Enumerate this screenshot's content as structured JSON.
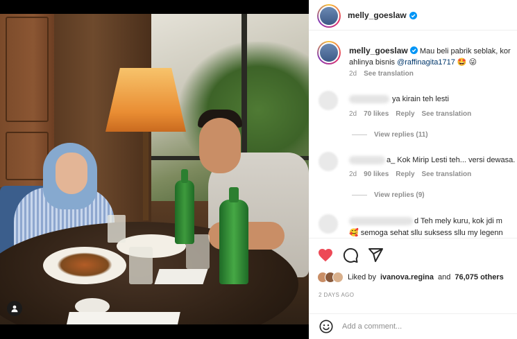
{
  "post": {
    "username": "melly_goeslaw",
    "verified_icon": "verified-badge-icon",
    "caption": {
      "username": "melly_goeslaw",
      "line1": "Mau beli pabrik seblak, kor",
      "line2_prefix": "ahlinya bisnis ",
      "mention": "@raffinagita1717",
      "emojis": "🤩 😜",
      "time": "2d",
      "translate": "See translation"
    }
  },
  "comments": [
    {
      "text": "ya kirain teh lesti",
      "time": "2d",
      "likes": "70 likes",
      "reply": "Reply",
      "translate": "See translation",
      "view_replies": "View replies (11)"
    },
    {
      "text": "a_ Kok Mirip Lesti teh... versi dewasa.",
      "time": "2d",
      "likes": "90 likes",
      "reply": "Reply",
      "translate": "See translation",
      "view_replies": "View replies (9)"
    },
    {
      "text_line1": "d Teh mely kuru, kok jdi m",
      "text_line2": "semoga sehat sllu suksess sllu my legenn"
    }
  ],
  "actions": {
    "like_icon": "heart-icon",
    "comment_icon": "comment-icon",
    "share_icon": "share-icon",
    "liked_prefix": "Liked by",
    "liked_user": "ivanova.regina",
    "liked_mid": "and",
    "liked_count": "76,075 others",
    "date": "2 DAYS AGO"
  },
  "add_comment": {
    "placeholder": "Add a comment...",
    "emoji_icon": "smiley-icon"
  },
  "colors": {
    "like_red": "#ed4956",
    "verified_blue": "#0095f6",
    "mention_blue": "#00376b",
    "muted": "#8e8e8e"
  }
}
